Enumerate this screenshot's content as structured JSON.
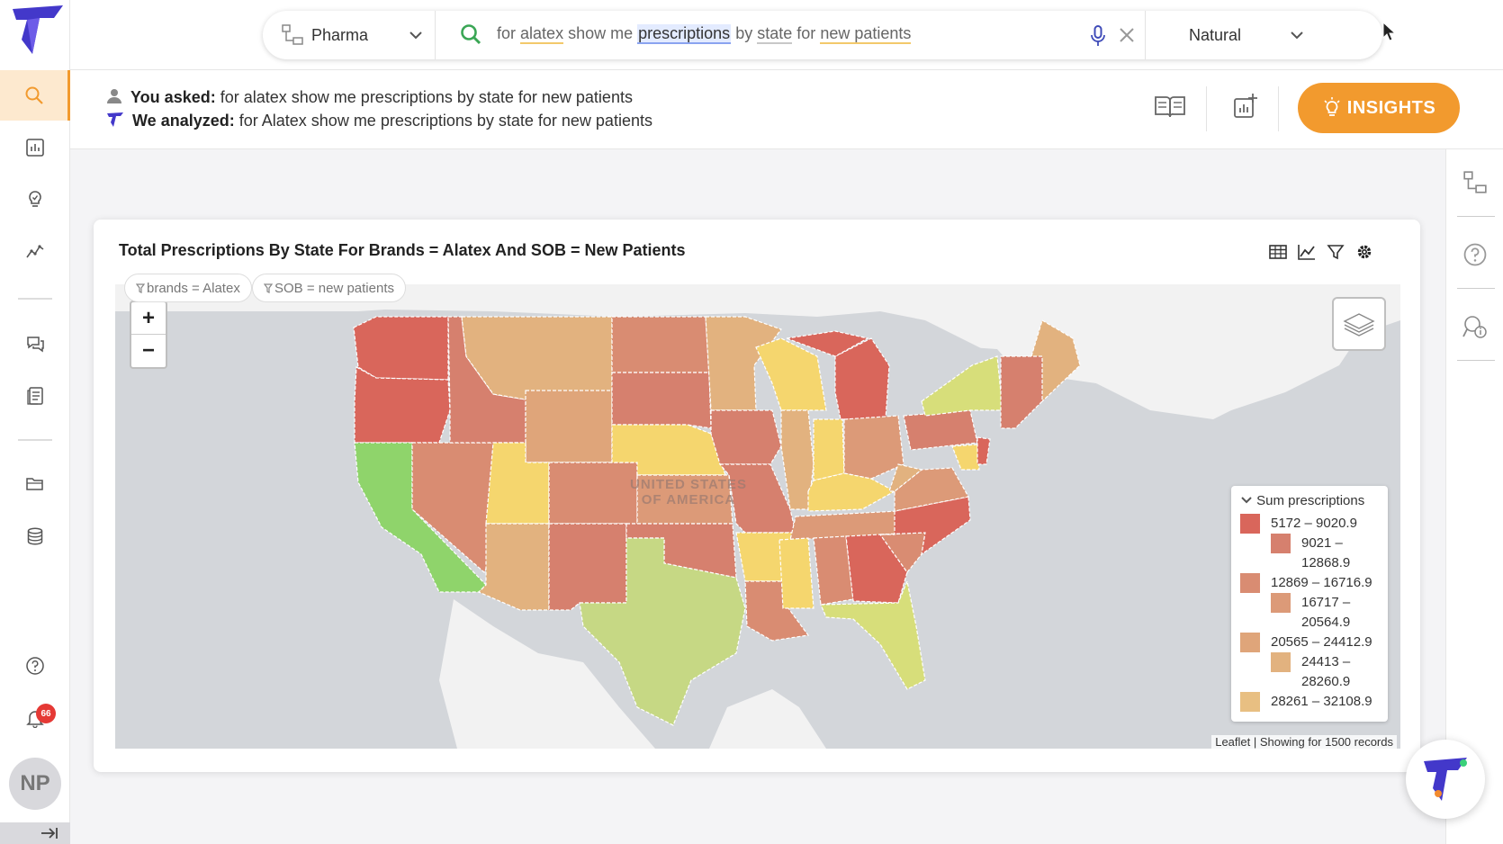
{
  "app": {
    "logo": "thoughtspot-like-logo",
    "user_initials": "NP",
    "notification_count": "66"
  },
  "sidebar": {
    "items": [
      {
        "name": "search",
        "icon": "search-icon",
        "active": true
      },
      {
        "name": "dashboards",
        "icon": "bar-chart-icon"
      },
      {
        "name": "insights",
        "icon": "lightbulb-icon"
      },
      {
        "name": "trends",
        "icon": "line-chart-icon"
      },
      {
        "name": "conversations",
        "icon": "chat-icon"
      },
      {
        "name": "reports",
        "icon": "document-icon"
      },
      {
        "name": "folders",
        "icon": "folder-icon"
      },
      {
        "name": "data",
        "icon": "database-icon"
      }
    ]
  },
  "search": {
    "dataset": "Pharma",
    "query_tokens": [
      {
        "text": "for",
        "style": "dim"
      },
      {
        "text": "alatex",
        "style": "yellow"
      },
      {
        "text": "show me",
        "style": "dim"
      },
      {
        "text": "prescriptions",
        "style": "blue"
      },
      {
        "text": "by",
        "style": "dim"
      },
      {
        "text": "state",
        "style": "gray"
      },
      {
        "text": "for",
        "style": "dim"
      },
      {
        "text": "new patients",
        "style": "yellow"
      }
    ],
    "mode": "Natural"
  },
  "ask": {
    "asked_label": "You asked:",
    "asked_text": "for alatex show me prescriptions by state for new patients",
    "analyzed_label": "We analyzed:",
    "analyzed_text": "for Alatex show me prescriptions by state for new patients",
    "insights_label": "INSIGHTS"
  },
  "card": {
    "title": "Total Prescriptions By State For Brands = Alatex And SOB = New Patients",
    "filters": [
      "brands = Alatex",
      "SOB = new patients"
    ],
    "map_label_line1": "UNITED STATES",
    "map_label_line2": "OF AMERICA",
    "attribution": "Leaflet | Showing for 1500 records"
  },
  "chart_data": {
    "type": "choropleth",
    "title": "Total Prescriptions By State For Brands = Alatex And SOB = New Patients",
    "legend_title": "Sum prescriptions",
    "legend": [
      {
        "range": "5172 – 9020.9",
        "color": "#d9665b"
      },
      {
        "range": "9021 – 12868.9",
        "color": "#d6806e"
      },
      {
        "range": "12869 – 16716.9",
        "color": "#d98c72"
      },
      {
        "range": "16717 – 20564.9",
        "color": "#dc9a78"
      },
      {
        "range": "20565 – 24412.9",
        "color": "#dfa57a"
      },
      {
        "range": "24413 – 28260.9",
        "color": "#e2b27f"
      },
      {
        "range": "28261 – 32108.9",
        "color": "#e8bf82"
      }
    ],
    "state_colors": {
      "WA": "#d9665b",
      "OR": "#d9665b",
      "CA": "#8fd46b",
      "NV": "#d98c72",
      "ID": "#d6806e",
      "MT": "#e2b27f",
      "WY": "#dfa57a",
      "UT": "#f5d66e",
      "AZ": "#e2b27f",
      "CO": "#d98c72",
      "NM": "#d6806e",
      "ND": "#d98c72",
      "SD": "#d6806e",
      "NE": "#f5d66e",
      "KS": "#dc9a78",
      "OK": "#d6806e",
      "TX": "#c6d884",
      "MN": "#e2b27f",
      "IA": "#d6806e",
      "MO": "#d6806e",
      "AR": "#f5d66e",
      "LA": "#d98c72",
      "WI": "#f5d66e",
      "IL": "#e2b27f",
      "MI": "#d9665b",
      "IN": "#f5d66e",
      "OH": "#dc9a78",
      "KY": "#f5d66e",
      "TN": "#dc9a78",
      "MS": "#f5d66e",
      "AL": "#d98c72",
      "GA": "#d9665b",
      "FL": "#d7de7a",
      "SC": "#d98c72",
      "NC": "#d9665b",
      "VA": "#dc9a78",
      "WV": "#e2b27f",
      "PA": "#d6806e",
      "NY": "#d7de7a",
      "ME": "#e2b27f",
      "NE_states": "#d6806e",
      "MD": "#f5d66e",
      "NJ": "#d9665b"
    }
  },
  "right_rail": [
    "datasource-icon",
    "help-icon",
    "explain-icon"
  ]
}
